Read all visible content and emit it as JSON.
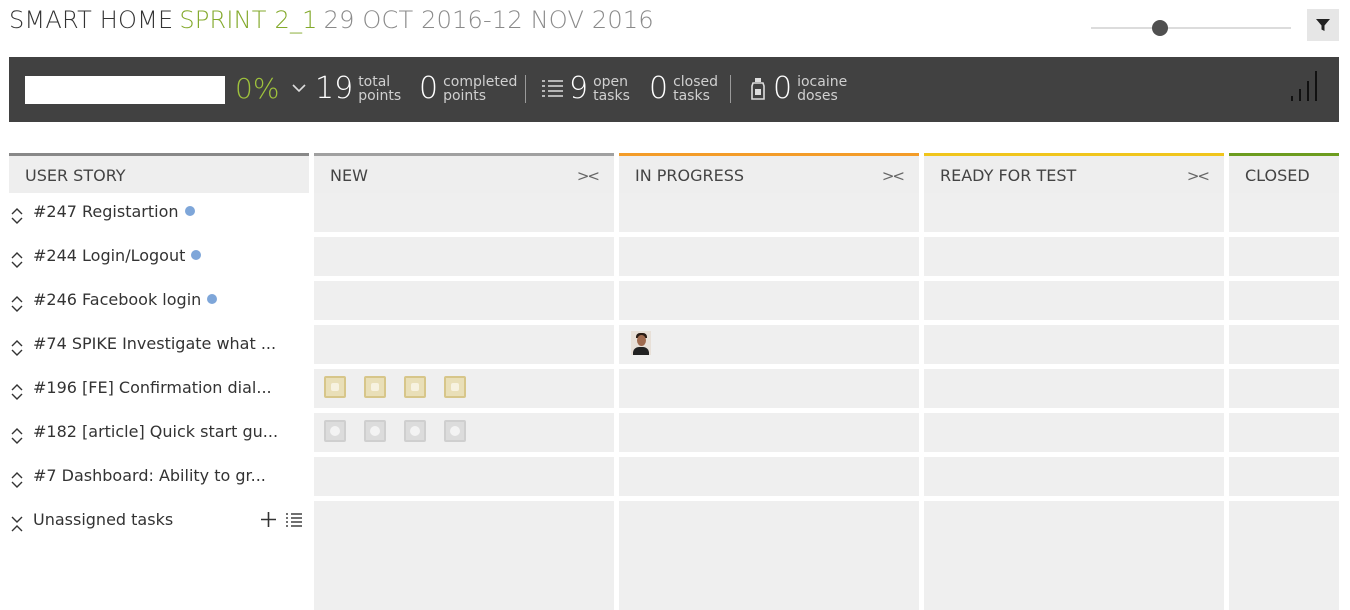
{
  "header": {
    "project": "SMART HOME",
    "sprint": "SPRINT 2_1",
    "dates": "29 OCT 2016-12 NOV 2016"
  },
  "stats": {
    "percent": "0%",
    "total_points": "19",
    "total_points_label1": "total",
    "total_points_label2": "points",
    "completed_points": "0",
    "completed_label1": "completed",
    "completed_label2": "points",
    "open_tasks": "9",
    "open_label1": "open",
    "open_label2": "tasks",
    "closed_tasks": "0",
    "closed_label1": "closed",
    "closed_label2": "tasks",
    "iocaine": "0",
    "iocaine_label1": "iocaine",
    "iocaine_label2": "doses"
  },
  "columns": {
    "story": "USER STORY",
    "new": "NEW",
    "in_progress": "IN PROGRESS",
    "ready_for_test": "READY FOR TEST",
    "closed": "CLOSED",
    "colors": {
      "story": "#888888",
      "new": "#a0a0a0",
      "in_progress": "#f39c28",
      "ready_for_test": "#f0c51c",
      "closed": "#6c9c1e"
    }
  },
  "stories": [
    {
      "label": "#247 Registartion",
      "dot": true
    },
    {
      "label": "#244 Login/Logout",
      "dot": true
    },
    {
      "label": "#246 Facebook login",
      "dot": true
    },
    {
      "label": "#74 SPIKE Investigate what ...",
      "dot": false
    },
    {
      "label": "#196 [FE] Confirmation dial...",
      "dot": false
    },
    {
      "label": "#182 [article] Quick start gu...",
      "dot": false
    },
    {
      "label": "#7 Dashboard: Ability to gr...",
      "dot": false
    }
  ],
  "unassigned": {
    "label": "Unassigned tasks"
  },
  "icons": {
    "filter": "filter-icon",
    "expand": "expand-icon",
    "fold": "fold-column-icon",
    "tasks_list": "list-icon",
    "iocaine": "iocaine-bottle-icon",
    "chart": "signal-bars-icon",
    "add": "plus-icon"
  }
}
